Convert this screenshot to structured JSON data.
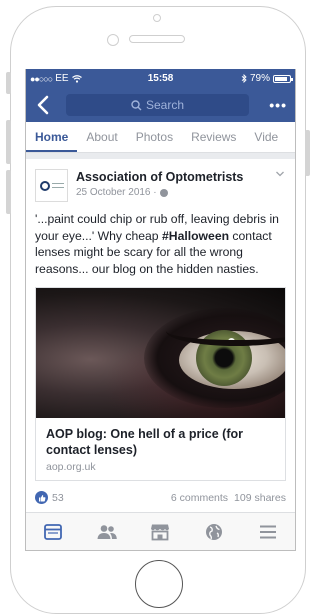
{
  "status_bar": {
    "carrier": "EE",
    "signal_dots": "●●○○○",
    "time": "15:58",
    "battery_percent": "79%"
  },
  "nav": {
    "search_placeholder": "Search",
    "more_label": "•••"
  },
  "tabs": [
    {
      "label": "Home",
      "active": true
    },
    {
      "label": "About",
      "active": false
    },
    {
      "label": "Photos",
      "active": false
    },
    {
      "label": "Reviews",
      "active": false
    },
    {
      "label": "Vide",
      "active": false
    }
  ],
  "post": {
    "page_name": "Association of Optometrists",
    "date": "25 October 2016 ·",
    "text_before": "'...paint could chip or rub off, leaving debris in your eye...' Why cheap ",
    "hashtag": "#Halloween",
    "text_after": " contact lenses might be scary for all the wrong reasons... our blog on the hidden nasties.",
    "link": {
      "title": "AOP blog: One hell of a price (for contact lenses)",
      "domain": "aop.org.uk"
    },
    "likes": "53",
    "comments": "6 comments",
    "shares": "109 shares"
  },
  "colors": {
    "brand": "#3b5998",
    "active_tab": "#3b5998",
    "muted_text": "#90949c",
    "bottom_icon": "#4267b2"
  },
  "bottom_bar": [
    {
      "icon": "news-feed-icon"
    },
    {
      "icon": "friends-icon"
    },
    {
      "icon": "marketplace-icon"
    },
    {
      "icon": "globe-icon"
    },
    {
      "icon": "menu-icon"
    }
  ]
}
